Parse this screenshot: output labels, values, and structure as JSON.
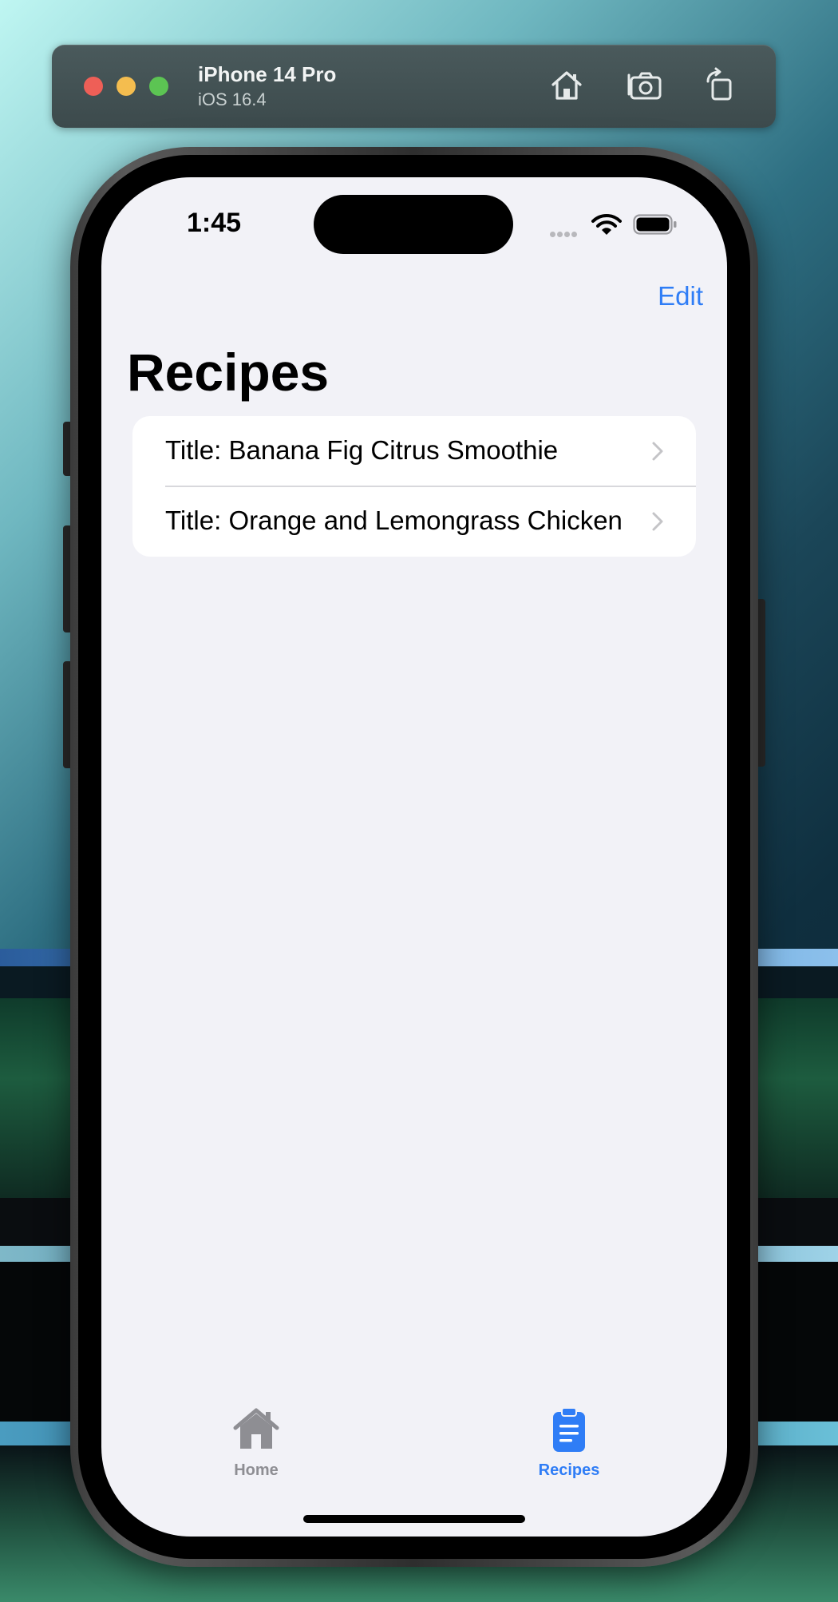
{
  "simulator": {
    "device_name": "iPhone 14 Pro",
    "os_version": "iOS 16.4",
    "icons": [
      "home-icon",
      "screenshot-icon",
      "rotate-icon"
    ]
  },
  "status_bar": {
    "time": "1:45"
  },
  "nav": {
    "edit_label": "Edit",
    "title": "Recipes"
  },
  "recipes": [
    {
      "label": "Title: Banana Fig Citrus Smoothie"
    },
    {
      "label": "Title: Orange and Lemongrass Chicken"
    }
  ],
  "tabs": [
    {
      "label": "Home",
      "icon": "house-icon",
      "selected": false
    },
    {
      "label": "Recipes",
      "icon": "clipboard-icon",
      "selected": true
    }
  ],
  "colors": {
    "accent": "#2f7df6",
    "background": "#f2f2f7",
    "inactive": "#8e8e93"
  }
}
